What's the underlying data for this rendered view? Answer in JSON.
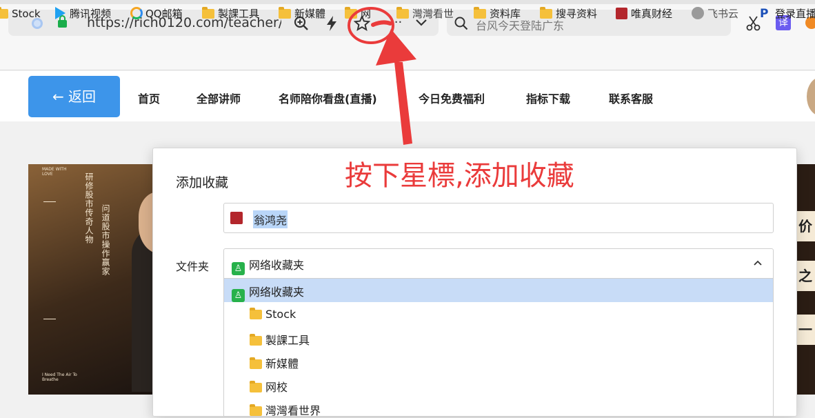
{
  "browser": {
    "url": "https://rich0120.com/teacher/",
    "search_placeholder": "台风今天登陆广东",
    "translate_label": "译"
  },
  "bookmarks": [
    {
      "label": "Stock",
      "icon": "folder-icon"
    },
    {
      "label": "腾讯视频",
      "icon": "tencent-video-icon"
    },
    {
      "label": "QQ邮箱",
      "icon": "qq-mail-icon"
    },
    {
      "label": "製課工具",
      "icon": "folder-icon"
    },
    {
      "label": "新媒體",
      "icon": "folder-icon"
    },
    {
      "label": "网",
      "icon": "folder-icon"
    },
    {
      "label": "灣灣看世",
      "icon": "folder-icon"
    },
    {
      "label": "资料库",
      "icon": "folder-icon"
    },
    {
      "label": "搜寻资料",
      "icon": "folder-icon"
    },
    {
      "label": "唯真财经",
      "icon": "weizhen-icon"
    },
    {
      "label": "飞书云",
      "icon": "feishu-icon"
    },
    {
      "label": "登录直播",
      "icon": "p-icon"
    }
  ],
  "site_nav": {
    "back_label": "← 返回",
    "items": [
      "首页",
      "全部讲师",
      "名师陪你看盘(直播)",
      "今日免费福利",
      "指标下载",
      "联系客服"
    ]
  },
  "banner": {
    "made_with_love": "MADE WITH LOVE",
    "line1": "研修股市传奇人物",
    "line2": "问道股市操作赢家",
    "footer": "I Need The Air To Breathe"
  },
  "right_panel": {
    "chip1": "价",
    "chip2": "之",
    "chip3": "一"
  },
  "dialog": {
    "title": "添加收藏",
    "name_value": "翁鸿尧",
    "folder_label": "文件夹",
    "folder_selected": "网络收藏夹",
    "options": [
      {
        "label": "网络收藏夹",
        "type": "root"
      },
      {
        "label": "Stock",
        "type": "folder"
      },
      {
        "label": "製課工具",
        "type": "folder"
      },
      {
        "label": "新媒體",
        "type": "folder"
      },
      {
        "label": "网校",
        "type": "folder"
      },
      {
        "label": "灣灣看世界",
        "type": "folder"
      }
    ]
  },
  "annotation": {
    "text": "按下星標,添加收藏",
    "color": "#ea3b3b"
  }
}
